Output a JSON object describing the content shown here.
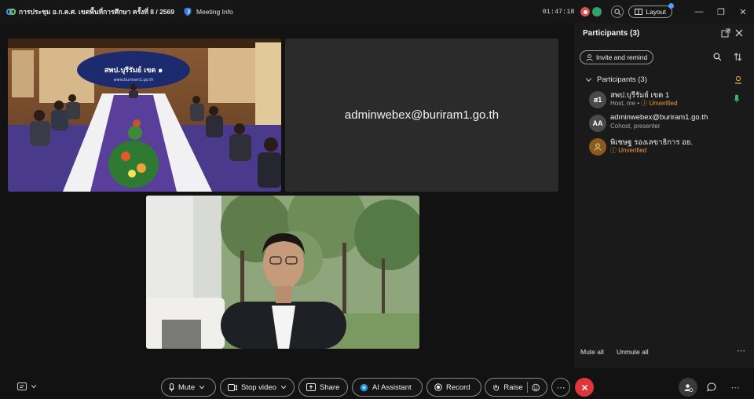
{
  "titlebar": {
    "meeting_title": "การประชุม อ.ก.ค.ศ. เขตพื้นที่การศึกษา ครั้งที่ 8 / 2569",
    "meeting_info": "Meeting Info",
    "timer": "01:47:18",
    "layout_label": "Layout"
  },
  "tiles": {
    "name_tile_label": "adminwebex@buriram1.go.th",
    "banner_text": "สพป.บุรีรัมย์ เขต ๑",
    "banner_sub": "www.buriram1.go.th"
  },
  "participants": {
    "title": "Participants (3)",
    "invite_label": "Invite and remind",
    "section_label": "Participants (3)",
    "list": [
      {
        "initials": "ส1",
        "name": "สพป.บุรีรัมย์ เขต 1",
        "role": "Host, me",
        "status": "Unverified"
      },
      {
        "initials": "AA",
        "name": "adminwebex@buriram1.go.th",
        "role": "Cohost, presenter",
        "status": ""
      },
      {
        "initials": "",
        "name": "พิเชษฐ รองเลขาธิการ อย.",
        "role": "",
        "status": "Unverified"
      }
    ],
    "mute_all": "Mute all",
    "unmute_all": "Unmute all"
  },
  "toolbar": {
    "mute": "Mute",
    "stop_video": "Stop video",
    "share": "Share",
    "ai_assistant": "AI Assistant",
    "record": "Record",
    "raise": "Raise"
  },
  "colors": {
    "accent_red": "#e0353b",
    "unverified": "#e7a13b",
    "panel_bg": "#1a1a1a"
  }
}
